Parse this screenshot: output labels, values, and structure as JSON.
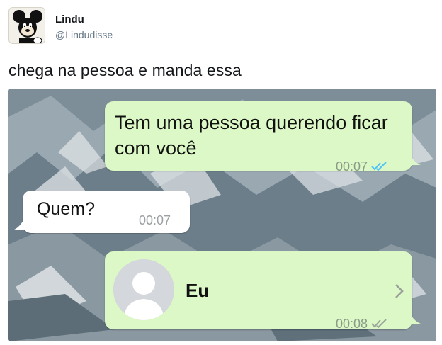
{
  "tweet": {
    "display_name": "Lindu",
    "handle": "@Lindudisse",
    "text": "chega na pessoa e manda essa"
  },
  "chat": {
    "messages": [
      {
        "text": "Tem uma pessoa querendo ficar com você",
        "time": "00:07",
        "ticks": "double-check-icon",
        "ticks_color": "#4fc3f7",
        "direction": "outgoing"
      },
      {
        "text": "Quem?",
        "time": "00:07",
        "direction": "incoming"
      },
      {
        "contact_name": "Eu",
        "time": "00:08",
        "ticks": "double-check-icon",
        "ticks_color": "#9aa59a",
        "direction": "outgoing"
      }
    ]
  },
  "colors": {
    "outgoing_bubble": "#dcf8c6",
    "incoming_bubble": "#ffffff",
    "read_ticks": "#4fc3f7",
    "handle_gray": "#657786"
  }
}
